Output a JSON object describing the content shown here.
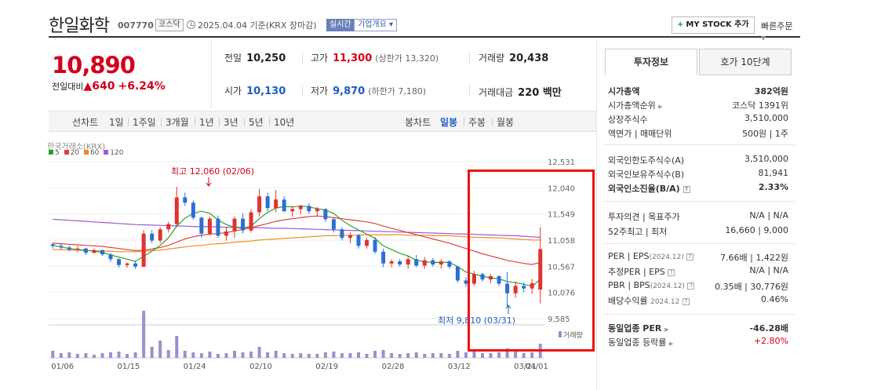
{
  "header": {
    "stock_name": "한일화학",
    "stock_code": "007770",
    "market_tag": "코스닥",
    "base_date": "2025.04.04  기준(KRX 장마감)",
    "realtime_label": "실시간",
    "company_info_label": "기업개요 ▾",
    "mystock_label": "MY STOCK 추가",
    "quick_order_label": "빠른주문"
  },
  "price": {
    "current": "10,890",
    "change_label": "전일대비",
    "change_value": "▲640",
    "change_pct": "+6.24%"
  },
  "quotes": {
    "prev_close_label": "전일",
    "prev_close": "10,250",
    "high_label": "고가",
    "high": "11,300",
    "upper_limit": "(상한가 13,320)",
    "volume_label": "거래량",
    "volume": "20,438",
    "open_label": "시가",
    "open": "10,130",
    "low_label": "저가",
    "low": "9,870",
    "lower_limit": "(하한가 7,180)",
    "amount_label": "거래대금",
    "amount": "220 백만"
  },
  "period_bar": {
    "line_label": "선차트",
    "line_items": [
      "1일",
      "1주일",
      "3개월",
      "1년",
      "3년",
      "5년",
      "10년"
    ],
    "candle_label": "봉차트",
    "candle_items": [
      "일봉",
      "주봉",
      "월봉"
    ],
    "candle_active": "일봉"
  },
  "chart": {
    "exchange_label": "한국거래소(KRX)",
    "ma_legend": [
      {
        "label": "5",
        "color": "#2aa02a"
      },
      {
        "label": "20",
        "color": "#e04040"
      },
      {
        "label": "60",
        "color": "#f08c1e"
      },
      {
        "label": "120",
        "color": "#9a5bd3"
      }
    ],
    "high_annotation": "최고 12,060 (02/06)",
    "low_annotation": "최저 9,810 (03/31)",
    "volume_label": "거래량",
    "up_color": "#e0322f",
    "down_color": "#2b6fd6"
  },
  "chart_data": {
    "type": "candlestick",
    "y_ticks": [
      "12,531",
      "12,040",
      "11,549",
      "11,058",
      "10,567",
      "10,076",
      "9,585"
    ],
    "ylim": [
      9585,
      12531
    ],
    "x_ticks": [
      "01/06",
      "01/15",
      "01/24",
      "02/10",
      "02/19",
      "02/28",
      "03/12",
      "03/21",
      "04/01"
    ],
    "candles": [
      [
        10980,
        11010,
        10900,
        10950
      ],
      [
        10950,
        11000,
        10880,
        10920
      ],
      [
        10920,
        10960,
        10850,
        10880
      ],
      [
        10880,
        10950,
        10830,
        10900
      ],
      [
        10900,
        10920,
        10780,
        10820
      ],
      [
        10820,
        10900,
        10800,
        10870
      ],
      [
        10870,
        10880,
        10760,
        10790
      ],
      [
        10790,
        10820,
        10650,
        10700
      ],
      [
        10700,
        10720,
        10540,
        10590
      ],
      [
        10590,
        10640,
        10540,
        10620
      ],
      [
        10620,
        10670,
        10520,
        10560
      ],
      [
        10560,
        11250,
        10550,
        11180
      ],
      [
        11180,
        11250,
        11000,
        11050
      ],
      [
        11050,
        11300,
        11000,
        11260
      ],
      [
        11260,
        11400,
        11200,
        11360
      ],
      [
        11360,
        12060,
        11300,
        11860
      ],
      [
        11860,
        11950,
        11700,
        11760
      ],
      [
        11760,
        11800,
        11440,
        11480
      ],
      [
        11480,
        11500,
        11100,
        11180
      ],
      [
        11180,
        11500,
        11150,
        11460
      ],
      [
        11460,
        11520,
        11100,
        11140
      ],
      [
        11140,
        11300,
        11050,
        11220
      ],
      [
        11220,
        11500,
        11100,
        11460
      ],
      [
        11460,
        11560,
        11180,
        11240
      ],
      [
        11240,
        11640,
        11200,
        11580
      ],
      [
        11580,
        12020,
        11500,
        11880
      ],
      [
        11880,
        11940,
        11600,
        11660
      ],
      [
        11660,
        12000,
        11580,
        11820
      ],
      [
        11820,
        11880,
        11580,
        11600
      ],
      [
        11600,
        11700,
        11500,
        11640
      ],
      [
        11640,
        11720,
        11540,
        11700
      ],
      [
        11700,
        11750,
        11550,
        11600
      ],
      [
        11600,
        11680,
        11500,
        11640
      ],
      [
        11640,
        11660,
        11400,
        11450
      ],
      [
        11450,
        11480,
        11200,
        11260
      ],
      [
        11260,
        11300,
        11050,
        11100
      ],
      [
        11100,
        11200,
        11000,
        11150
      ],
      [
        11150,
        11180,
        10900,
        10950
      ],
      [
        10950,
        11100,
        10900,
        11060
      ],
      [
        11060,
        11120,
        10800,
        10840
      ],
      [
        10840,
        10900,
        10550,
        10620
      ],
      [
        10620,
        10700,
        10550,
        10660
      ],
      [
        10660,
        10700,
        10560,
        10600
      ],
      [
        10600,
        10760,
        10520,
        10700
      ],
      [
        10700,
        10780,
        10550,
        10580
      ],
      [
        10580,
        10740,
        10520,
        10680
      ],
      [
        10680,
        10720,
        10560,
        10600
      ],
      [
        10600,
        10700,
        10520,
        10660
      ],
      [
        10660,
        10680,
        10520,
        10560
      ],
      [
        10560,
        10580,
        10260,
        10300
      ],
      [
        10300,
        10360,
        10180,
        10240
      ],
      [
        10240,
        10480,
        10200,
        10420
      ],
      [
        10420,
        10450,
        10280,
        10320
      ],
      [
        10320,
        10420,
        10250,
        10380
      ],
      [
        10380,
        10400,
        10200,
        10240
      ],
      [
        10240,
        10460,
        9810,
        10060
      ],
      [
        10060,
        10280,
        9980,
        10200
      ],
      [
        10200,
        10260,
        10080,
        10150
      ],
      [
        10150,
        10330,
        10050,
        10250
      ],
      [
        10130,
        11300,
        9870,
        10890
      ]
    ],
    "volumes": [
      9,
      6,
      7,
      5,
      6,
      4,
      6,
      7,
      8,
      5,
      7,
      60,
      14,
      22,
      10,
      28,
      9,
      7,
      6,
      8,
      5,
      6,
      9,
      7,
      8,
      14,
      7,
      9,
      6,
      5,
      6,
      5,
      5,
      7,
      8,
      6,
      6,
      7,
      5,
      9,
      10,
      6,
      5,
      6,
      7,
      5,
      6,
      6,
      5,
      9,
      7,
      8,
      6,
      6,
      7,
      12,
      8,
      6,
      7,
      18
    ],
    "ma5": [
      10960,
      10930,
      10900,
      10880,
      10870,
      10850,
      10830,
      10780,
      10740,
      10700,
      10660,
      10750,
      10850,
      10960,
      11100,
      11320,
      11470,
      11560,
      11600,
      11560,
      11440,
      11350,
      11300,
      11280,
      11320,
      11460,
      11580,
      11660,
      11690,
      11680,
      11700,
      11680,
      11650,
      11620,
      11560,
      11430,
      11330,
      11250,
      11170,
      11090,
      10950,
      10880,
      10810,
      10760,
      10680,
      10650,
      10640,
      10640,
      10640,
      10560,
      10460,
      10420,
      10380,
      10350,
      10330,
      10280,
      10260,
      10230,
      10190,
      10320
    ],
    "ma20": [
      11000,
      10990,
      10980,
      10970,
      10960,
      10950,
      10940,
      10920,
      10900,
      10880,
      10860,
      10870,
      10890,
      10920,
      10960,
      11020,
      11080,
      11120,
      11150,
      11170,
      11180,
      11200,
      11230,
      11260,
      11290,
      11330,
      11370,
      11410,
      11440,
      11460,
      11480,
      11500,
      11510,
      11500,
      11480,
      11460,
      11440,
      11420,
      11400,
      11370,
      11320,
      11280,
      11240,
      11200,
      11160,
      11120,
      11080,
      11040,
      11000,
      10950,
      10900,
      10850,
      10800,
      10760,
      10720,
      10680,
      10650,
      10620,
      10600,
      10640
    ],
    "ma60": [
      10880,
      10880,
      10870,
      10870,
      10860,
      10860,
      10850,
      10850,
      10840,
      10840,
      10840,
      10850,
      10860,
      10870,
      10890,
      10910,
      10930,
      10950,
      10960,
      10980,
      10990,
      11000,
      11020,
      11030,
      11040,
      11060,
      11070,
      11080,
      11090,
      11100,
      11110,
      11120,
      11130,
      11140,
      11140,
      11150,
      11150,
      11150,
      11160,
      11160,
      11160,
      11160,
      11160,
      11150,
      11150,
      11150,
      11140,
      11140,
      11140,
      11130,
      11120,
      11110,
      11110,
      11100,
      11100,
      11090,
      11080,
      11070,
      11060,
      11060
    ],
    "ma120": [
      11450,
      11440,
      11430,
      11420,
      11410,
      11400,
      11390,
      11380,
      11370,
      11360,
      11350,
      11345,
      11340,
      11335,
      11330,
      11325,
      11320,
      11315,
      11310,
      11310,
      11305,
      11300,
      11300,
      11295,
      11290,
      11290,
      11285,
      11280,
      11280,
      11275,
      11270,
      11265,
      11260,
      11255,
      11250,
      11245,
      11240,
      11235,
      11230,
      11225,
      11220,
      11215,
      11210,
      11205,
      11200,
      11195,
      11190,
      11185,
      11180,
      11175,
      11170,
      11165,
      11160,
      11155,
      11150,
      11145,
      11140,
      11130,
      11120,
      11110
    ]
  },
  "right_panel": {
    "tab_invest": "투자정보",
    "tab_orderbook": "호가 10단계",
    "rows": {
      "mktcap_k": "시가총액",
      "mktcap_v": "382억원",
      "rank_k": "시가총액순위",
      "rank_v": "코스닥 1391위",
      "shares_k": "상장주식수",
      "shares_v": "3,510,000",
      "par_k": "액면가 | 매매단위",
      "par_v": "500원 | 1주",
      "fl_limit_k": "외국인한도주식수(A)",
      "fl_limit_v": "3,510,000",
      "fl_hold_k": "외국인보유주식수(B)",
      "fl_hold_v": "81,941",
      "fl_ratio_k": "외국인소진율(B/A)",
      "fl_ratio_v": "2.33%",
      "opinion_k": "투자의견 | 목표주가",
      "opinion_v": "N/A | N/A",
      "w52_k": "52주최고 | 최저",
      "w52_v": "16,660 | 9,000",
      "per_k": "PER | EPS",
      "per_year": "(2024.12)",
      "per_v": "7.66배 | 1,422원",
      "fper_k": "추정PER | EPS",
      "fper_v": "N/A | N/A",
      "pbr_k": "PBR | BPS",
      "pbr_year": "(2024.12)",
      "pbr_v": "0.35배 | 30,776원",
      "div_k": "배당수익률",
      "div_year": "2024.12",
      "div_v": "0.46%",
      "sector_per_k": "동일업종 PER",
      "sector_per_v": "-46.28배",
      "sector_rate_k": "동일업종 등락률",
      "sector_rate_v": "+2.80%"
    }
  }
}
